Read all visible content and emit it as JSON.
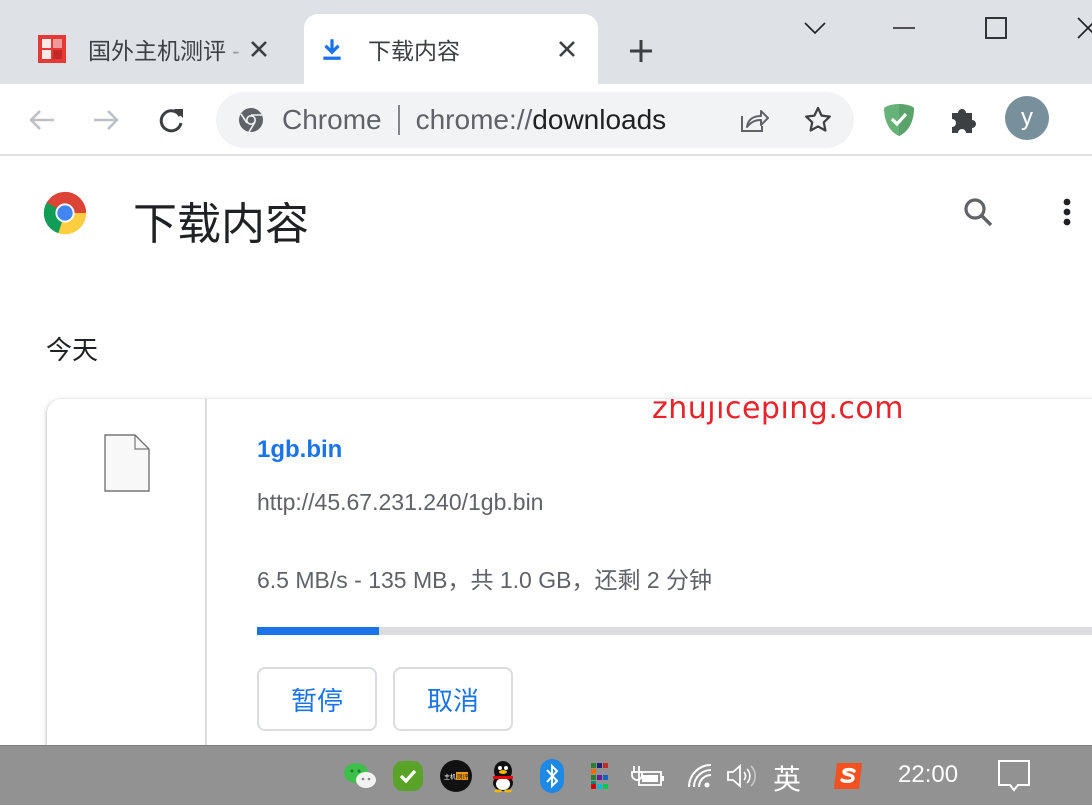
{
  "browser": {
    "tabs": [
      {
        "title": "国外主机测评 - ",
        "active": false,
        "favicon": "site-logo-red"
      },
      {
        "title": "下载内容",
        "active": true,
        "favicon": "download-icon"
      }
    ],
    "new_tab_icon": "plus-icon",
    "window_controls": [
      "tab-search-chevron",
      "minimize",
      "maximize",
      "close"
    ],
    "omnibox": {
      "chip": "Chrome",
      "url_scheme": "chrome://",
      "url_host": "downloads",
      "site_icon": "chrome-icon"
    },
    "avatar_letter": "y",
    "accent": "#1a73e8"
  },
  "page": {
    "title": "下载内容",
    "section_date": "今天",
    "watermark": "zhujiceping.com",
    "downloads": [
      {
        "file_name": "1gb.bin",
        "url": "http://45.67.231.240/1gb.bin",
        "status": "6.5 MB/s - 135 MB，共 1.0 GB，还剩 2 分钟",
        "progress_fraction": 0.135,
        "actions": [
          {
            "label": "暂停"
          },
          {
            "label": "取消"
          }
        ]
      }
    ]
  },
  "taskbar": {
    "tray_icons": [
      "wechat-icon",
      "check-shield-icon",
      "zhujiceping-icon",
      "qq-icon",
      "bluetooth-icon",
      "color-grid-icon",
      "power-battery-icon",
      "wifi-icon",
      "volume-icon"
    ],
    "ime": "英",
    "ime_app": "sogou-icon",
    "clock": "22:00",
    "notification_icon": "action-center-icon"
  }
}
